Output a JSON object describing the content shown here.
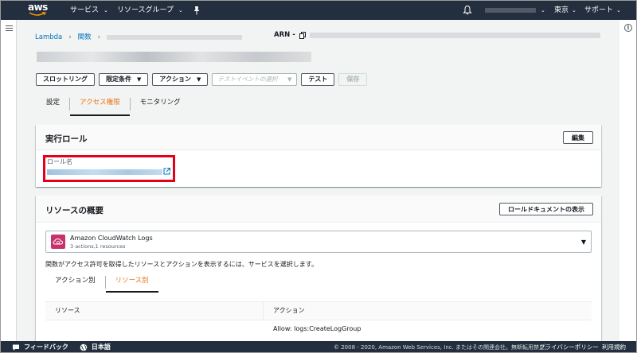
{
  "topnav": {
    "logo_text": "aws",
    "services_label": "サービス",
    "resource_groups_label": "リソースグループ",
    "region_label": "東京",
    "support_label": "サポート"
  },
  "breadcrumb": {
    "lambda": "Lambda",
    "functions": "関数"
  },
  "arn_label": "ARN -",
  "toolbar": {
    "throttle": "スロットリング",
    "qualifiers": "限定条件",
    "actions": "アクション",
    "test_event_placeholder": "テストイベントの選択",
    "test": "テスト",
    "save": "保存"
  },
  "tabs": [
    {
      "label": "設定"
    },
    {
      "label": "アクセス権限"
    },
    {
      "label": "モニタリング"
    }
  ],
  "execution_role": {
    "title": "実行ロール",
    "edit_button": "編集",
    "role_name_label": "ロール名"
  },
  "resource_summary": {
    "title": "リソースの概要",
    "view_doc_button": "ロールドキュメントの表示",
    "service_name": "Amazon CloudWatch Logs",
    "service_sub": "3 actions,1 resources",
    "description": "関数がアクセス許可を取得したリソースとアクションを表示するには、サービスを選択します。",
    "subtabs": [
      {
        "label": "アクション別"
      },
      {
        "label": "リソース別"
      }
    ],
    "table": {
      "col_resource": "リソース",
      "col_action": "アクション",
      "row_action": "Allow: logs:CreateLogGroup"
    }
  },
  "footer": {
    "feedback": "フィードバック",
    "language": "日本語",
    "copyright": "© 2008 - 2020, Amazon Web Services, Inc. またはその関連会社。無断転用禁止。",
    "privacy": "プライバシーポリシー",
    "terms": "利用規約"
  },
  "colors": {
    "nav_bg": "#232f3e",
    "accent": "#ec7211",
    "link": "#0073bb",
    "highlight": "#e2001a",
    "cloudwatch": "#c7326a"
  }
}
